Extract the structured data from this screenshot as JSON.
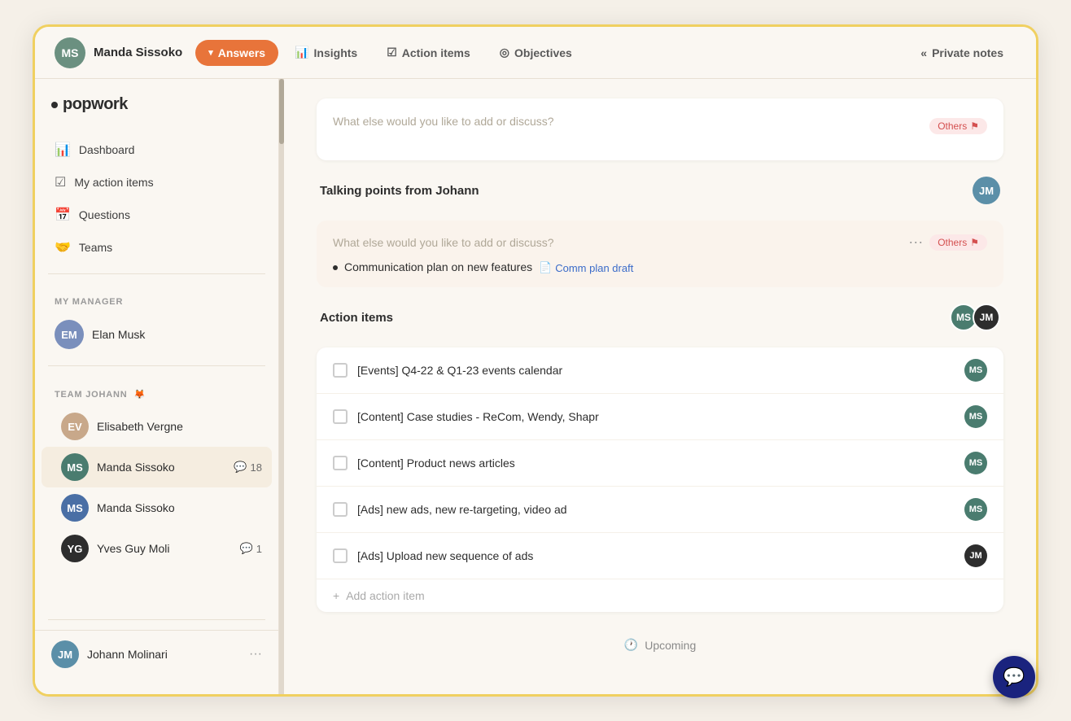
{
  "app": {
    "logo": "popwork",
    "logo_dot": "•"
  },
  "header": {
    "user": {
      "name": "Manda Sissoko",
      "avatar_initials": "MS",
      "avatar_color": "#6b9080"
    },
    "tabs": [
      {
        "id": "answers",
        "label": "Answers",
        "icon": "▾",
        "active": true
      },
      {
        "id": "insights",
        "label": "Insights",
        "icon": "📊",
        "active": false
      },
      {
        "id": "action-items",
        "label": "Action items",
        "icon": "☑",
        "active": false
      },
      {
        "id": "objectives",
        "label": "Objectives",
        "icon": "◎",
        "active": false
      }
    ],
    "private_notes": "Private notes",
    "private_notes_icon": "«"
  },
  "sidebar": {
    "nav": [
      {
        "id": "dashboard",
        "label": "Dashboard",
        "icon": "📊"
      },
      {
        "id": "my-action-items",
        "label": "My action items",
        "icon": "☑"
      },
      {
        "id": "questions",
        "label": "Questions",
        "icon": "📅"
      },
      {
        "id": "teams",
        "label": "Teams",
        "icon": "🤝"
      }
    ],
    "manager_section": "MY MANAGER",
    "manager": {
      "name": "Elan Musk",
      "avatar_initials": "EM",
      "avatar_color": "#7a8fbc"
    },
    "team_section": "TEAM JOHANN",
    "team_emoji": "🦊",
    "team_members": [
      {
        "name": "Elisabeth Vergne",
        "avatar_initials": "EV",
        "avatar_color": "#c8a88a",
        "active": false,
        "comment_count": null
      },
      {
        "name": "Manda Sissoko",
        "avatar_initials": "MS",
        "avatar_color": "#4a7c6f",
        "active": true,
        "comment_count": 18
      },
      {
        "name": "Manda Sissoko",
        "avatar_initials": "MS",
        "avatar_color": "#4a6fa5",
        "active": false,
        "comment_count": null
      },
      {
        "name": "Yves Guy Moli",
        "avatar_initials": "YG",
        "avatar_color": "#2d2d2d",
        "active": false,
        "comment_count": 1
      }
    ],
    "footer_user": {
      "name": "Johann Molinari",
      "avatar_initials": "JM",
      "avatar_color": "#5b8fa8"
    }
  },
  "content": {
    "top_card": {
      "placeholder": "What else would you like to add or discuss?",
      "tag": "Others",
      "tag_icon": "⚑"
    },
    "talking_points": {
      "title": "Talking points from Johann",
      "avatar_initials": "JM",
      "avatar_color": "#5b8fa8",
      "placeholder": "What else would you like to add or discuss?",
      "tag": "Others",
      "tag_icon": "⚑",
      "items": [
        {
          "text": "Communication plan on new features",
          "link_label": "Comm plan draft",
          "link_icon": "📄"
        }
      ]
    },
    "action_items": {
      "title": "Action items",
      "avatars": [
        {
          "initials": "MS",
          "color": "#4a7c6f"
        },
        {
          "initials": "JM",
          "color": "#2d2d2d"
        }
      ],
      "items": [
        {
          "text": "[Events] Q4-22 & Q1-23 events calendar",
          "avatar_initials": "MS",
          "avatar_color": "#4a7c6f"
        },
        {
          "text": "[Content] Case studies - ReCom, Wendy, Shapr",
          "avatar_initials": "MS",
          "avatar_color": "#4a7c6f"
        },
        {
          "text": "[Content] Product news articles",
          "avatar_initials": "MS",
          "avatar_color": "#4a7c6f"
        },
        {
          "text": "[Ads] new ads, new re-targeting, video ad",
          "avatar_initials": "MS",
          "avatar_color": "#4a7c6f"
        },
        {
          "text": "[Ads] Upload new sequence of ads",
          "avatar_initials": "JM",
          "avatar_color": "#2d2d2d"
        }
      ],
      "add_label": "Add action item"
    },
    "upcoming": {
      "label": "Upcoming",
      "icon": "🕐"
    }
  }
}
